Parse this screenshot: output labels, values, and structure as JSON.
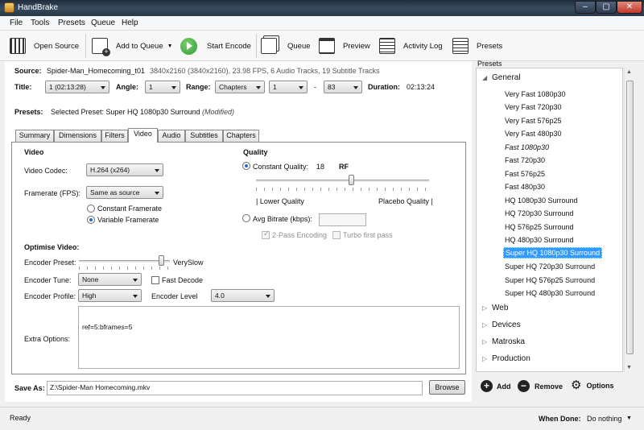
{
  "window": {
    "title": "HandBrake"
  },
  "menu": [
    "File",
    "Tools",
    "Presets",
    "Queue",
    "Help"
  ],
  "toolbar": {
    "open_source": "Open Source",
    "add_to_queue": "Add to Queue",
    "start_encode": "Start Encode",
    "queue": "Queue",
    "preview": "Preview",
    "activity_log": "Activity Log",
    "presets": "Presets"
  },
  "source": {
    "label": "Source:",
    "name": "Spider-Man_Homecoming_t01",
    "info": "3840x2160 (3840x2160), 23.98 FPS, 6 Audio Tracks, 19 Subtitle Tracks"
  },
  "title_row": {
    "title_label": "Title:",
    "title_value": "1 (02:13:28)",
    "angle_label": "Angle:",
    "angle_value": "1",
    "range_label": "Range:",
    "range_value": "Chapters",
    "range_start": "1",
    "range_dash": "-",
    "range_end": "83",
    "duration_label": "Duration:",
    "duration_value": "02:13:24"
  },
  "presets_row": {
    "label": "Presets:",
    "text": "Selected Preset: Super HQ 1080p30 Surround",
    "modified": "(Modified)"
  },
  "tabs": [
    "Summary",
    "Dimensions",
    "Filters",
    "Video",
    "Audio",
    "Subtitles",
    "Chapters"
  ],
  "video": {
    "section": "Video",
    "codec_label": "Video Codec:",
    "codec_value": "H.264 (x264)",
    "framerate_label": "Framerate (FPS):",
    "framerate_value": "Same as source",
    "constant_fr": "Constant Framerate",
    "variable_fr": "Variable Framerate"
  },
  "quality": {
    "section": "Quality",
    "constant_quality_label": "Constant Quality:",
    "cq_value": "18",
    "rf": "RF",
    "cq_level": 0.55,
    "lower": "| Lower Quality",
    "placebo": "Placebo Quality |",
    "avg_bitrate_label": "Avg Bitrate (kbps):",
    "avg_bitrate_value": "",
    "two_pass": "2-Pass Encoding",
    "turbo": "Turbo first pass"
  },
  "optimise": {
    "section": "Optimise Video:",
    "preset_label": "Encoder Preset:",
    "preset_value": "VerySlow",
    "preset_level": 0.9,
    "tune_label": "Encoder Tune:",
    "tune_value": "None",
    "fast_decode": "Fast Decode",
    "profile_label": "Encoder Profile:",
    "profile_value": "High",
    "level_label": "Encoder Level",
    "level_value": "4.0",
    "extra_label": "Extra Options:",
    "extra_value": "ref=5:bframes=5"
  },
  "save": {
    "label": "Save As:",
    "path": "Z:\\Spider-Man Homecoming.mkv",
    "browse": "Browse"
  },
  "presets_panel": {
    "heading": "Presets",
    "general": "General",
    "general_items": [
      "Very Fast 1080p30",
      "Very Fast 720p30",
      "Very Fast 576p25",
      "Very Fast 480p30",
      "Fast 1080p30",
      "Fast 720p30",
      "Fast 576p25",
      "Fast 480p30",
      "HQ 1080p30 Surround",
      "HQ 720p30 Surround",
      "HQ 576p25 Surround",
      "HQ 480p30 Surround",
      "Super HQ 1080p30 Surround",
      "Super HQ 720p30 Surround",
      "Super HQ 576p25 Surround",
      "Super HQ 480p30 Surround"
    ],
    "groups": [
      "Web",
      "Devices",
      "Matroska",
      "Production"
    ],
    "add": "Add",
    "remove": "Remove",
    "options": "Options"
  },
  "status": {
    "text": "Ready",
    "when_done_label": "When Done:",
    "when_done_value": "Do nothing"
  },
  "colors": {
    "selection": "#3399ff",
    "titlebar": "#2b3b4d",
    "start_green": "#2f9a3a"
  }
}
